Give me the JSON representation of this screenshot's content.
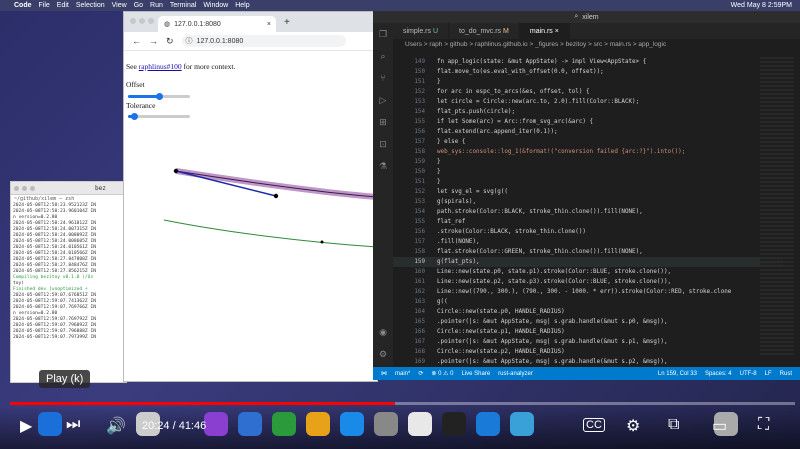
{
  "menubar": {
    "apple": "",
    "app": "Code",
    "items": [
      "File",
      "Edit",
      "Selection",
      "View",
      "Go",
      "Run",
      "Terminal",
      "Window",
      "Help"
    ],
    "clock": "Wed May 8  2:59PM"
  },
  "terminal": {
    "title": "bez",
    "path": "~/github/xilem — zsh",
    "lines": [
      "2024-05-08T12:58:23.952123Z  IN",
      "2024-05-08T12:58:23.960104Z  IN",
      "n version=0.2.80",
      "2024-05-08T12:58:24.961012Z  IN",
      "2024-05-08T12:58:24.007315Z  IN",
      "2024-05-08T12:58:24.008092Z  IN",
      "2024-05-08T12:58:24.008605Z  IN",
      "2024-05-08T12:58:24.010561Z  IN",
      "2024-05-08T12:58:24.010566Z  IN",
      "2024-05-08T12:58:27.847808Z  IN",
      "2024-05-08T12:58:27.848476Z  IN",
      "2024-05-08T12:58:27.856215Z  IN",
      "   Compiling bezitoy v0.1.0 (/Us",
      "toy)",
      "    Finished dev [unoptimized +",
      "2024-05-08T12:59:07.676851Z  IN",
      "2024-05-08T12:59:07.741362Z  IN",
      "2024-05-08T12:59:07.769766Z  IN",
      "n version=0.2.80",
      "2024-05-08T12:59:07.769792Z  IN",
      "2024-05-08T12:59:07.796092Z  IN",
      "2024-05-08T12:59:07.796888Z  IN",
      "2024-05-08T12:59:07.797399Z  IN"
    ]
  },
  "browser": {
    "tab_title": "127.0.0.1:8080",
    "url": "127.0.0.1:8080",
    "see_prefix": "See ",
    "see_link": "raphlinus#100",
    "see_suffix": " for more context.",
    "offset_label": "Offset",
    "tolerance_label": "Tolerance",
    "offset_value": 0.5,
    "tolerance_value": 0.1
  },
  "vscode": {
    "title": "xilem",
    "tabs": [
      {
        "label": "simple.rs",
        "badge": "U"
      },
      {
        "label": "to_do_mvc.rs",
        "badge": "M"
      },
      {
        "label": "main.rs",
        "badge": ""
      }
    ],
    "breadcrumb": "Users > raph > github > raphlinus.github.io > _figures > bezitoy > src > main.rs > app_logic",
    "code": [
      {
        "n": "149",
        "t": "    fn app_logic(state: &mut AppState) -> impl View<AppState> {"
      },
      {
        "n": "150",
        "t": "            flat.move_to(es.eval_with_offset(0.0, offset));"
      },
      {
        "n": "151",
        "t": "        }"
      },
      {
        "n": "152",
        "t": "        for arc in espc_to_arcs(&es, offset, tol) {"
      },
      {
        "n": "153",
        "t": "            let circle = Circle::new(arc.to, 2.0).fill(Color::BLACK);"
      },
      {
        "n": "154",
        "t": "            flat_pts.push(circle);"
      },
      {
        "n": "155",
        "t": "            if let Some(arc) = Arc::from_svg_arc(&arc) {"
      },
      {
        "n": "156",
        "t": "                flat.extend(arc.append_iter(0.1));"
      },
      {
        "n": "157",
        "t": "            } else {"
      },
      {
        "n": "158",
        "t": "                web_sys::console::log_1(&format!(\"conversion failed {arc:?}\").into());"
      },
      {
        "n": "159",
        "t": "            }"
      },
      {
        "n": "150",
        "t": "        }"
      },
      {
        "n": "151",
        "t": "    }"
      },
      {
        "n": "152",
        "t": "    let svg_el = svg(g(("
      },
      {
        "n": "153",
        "t": "        g(spirals),"
      },
      {
        "n": "154",
        "t": "        path.stroke(Color::BLACK, stroke_thin.clone()).fill(NONE),"
      },
      {
        "n": "155",
        "t": "        flat_ref"
      },
      {
        "n": "156",
        "t": "            .stroke(Color::BLACK, stroke_thin.clone())"
      },
      {
        "n": "157",
        "t": "            .fill(NONE),"
      },
      {
        "n": "158",
        "t": "        flat.stroke(Color::GREEN, stroke_thin.clone()).fill(NONE),"
      },
      {
        "n": "159",
        "t": "        g(flat_pts),",
        "cur": true
      },
      {
        "n": "160",
        "t": "        Line::new(state.p0, state.p1).stroke(Color::BLUE, stroke.clone()),"
      },
      {
        "n": "161",
        "t": "        Line::new(state.p2, state.p3).stroke(Color::BLUE, stroke.clone()),"
      },
      {
        "n": "162",
        "t": "        Line::new((790., 300.), (790., 300. - 1000. * err)).stroke(Color::RED, stroke.clone"
      },
      {
        "n": "163",
        "t": "        g(("
      },
      {
        "n": "164",
        "t": "            Circle::new(state.p0, HANDLE_RADIUS)"
      },
      {
        "n": "165",
        "t": "                .pointer(|s: &mut AppState, msg| s.grab.handle(&mut s.p0, &msg)),"
      },
      {
        "n": "166",
        "t": "            Circle::new(state.p1, HANDLE_RADIUS)"
      },
      {
        "n": "167",
        "t": "                .pointer(|s: &mut AppState, msg| s.grab.handle(&mut s.p1, &msg)),"
      },
      {
        "n": "168",
        "t": "            Circle::new(state.p2, HANDLE_RADIUS)"
      },
      {
        "n": "169",
        "t": "                .pointer(|s: &mut AppState, msg| s.grab.handle(&mut s.p2, &msg)),"
      },
      {
        "n": "170",
        "t": "            Circle::new(state.p3, HANDLE_RADIUS)"
      },
      {
        "n": "171",
        "t": "                .pointer(|s: &mut AppState, msg| s.grab.handle(&mut s.p3, &msg)),"
      }
    ],
    "status": {
      "branch": "main*",
      "sync": "⟳",
      "errors": "⊗ 0  ⚠ 0",
      "live": "Live Share",
      "analyzer": "rust-analyzer",
      "pos": "Ln 159, Col 33",
      "spaces": "Spaces: 4",
      "enc": "UTF-8",
      "eol": "LF",
      "lang": "Rust"
    }
  },
  "video": {
    "tooltip": "Play (k)",
    "time": "20:24 / 41:46",
    "played_fraction": 0.49
  },
  "icons": {
    "play": "play-icon",
    "next": "next-icon",
    "volume": "volume-icon",
    "cc": "captions-icon",
    "settings": "gear-icon",
    "miniplayer": "miniplayer-icon",
    "theater": "theater-icon",
    "fullscreen": "fullscreen-icon"
  }
}
